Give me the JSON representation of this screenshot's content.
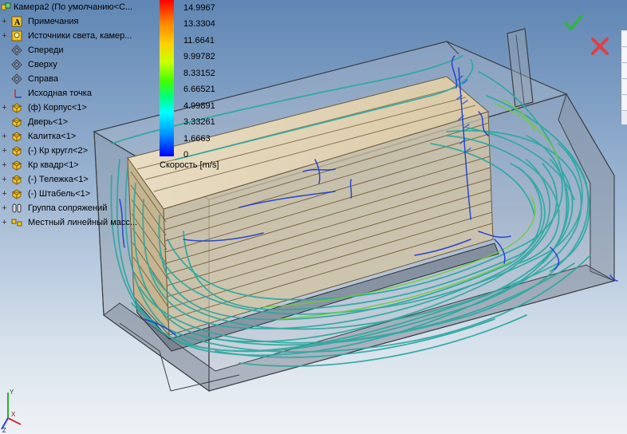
{
  "tree": {
    "root": {
      "label": "Камера2  (По умолчанию<С...",
      "icon": "assembly-icon"
    },
    "items": [
      {
        "label": "Примечания",
        "icon": "annotations-icon",
        "expandable": true
      },
      {
        "label": "Источники света, камер...",
        "icon": "lights-icon",
        "expandable": true
      },
      {
        "label": "Спереди",
        "icon": "plane-icon",
        "expandable": false
      },
      {
        "label": "Сверху",
        "icon": "plane-icon",
        "expandable": false
      },
      {
        "label": "Справа",
        "icon": "plane-icon",
        "expandable": false
      },
      {
        "label": "Исходная точка",
        "icon": "origin-icon",
        "expandable": false
      },
      {
        "label": "(ф) Корпус<1>",
        "icon": "part-icon",
        "expandable": true
      },
      {
        "label": "Дверь<1>",
        "icon": "part-icon",
        "expandable": false
      },
      {
        "label": "Калитка<1>",
        "icon": "part-icon",
        "expandable": true
      },
      {
        "label": "(-) Кр кругл<2>",
        "icon": "part-icon",
        "expandable": true
      },
      {
        "label": "Кр квадр<1>",
        "icon": "part-icon",
        "expandable": true
      },
      {
        "label": "(-) Тележка<1>",
        "icon": "part-icon",
        "expandable": true
      },
      {
        "label": "(-) Штабель<1>",
        "icon": "part-icon",
        "expandable": true
      },
      {
        "label": "Группа сопряжений",
        "icon": "mates-icon",
        "expandable": true
      },
      {
        "label": "Местный линейный масс...",
        "icon": "pattern-icon",
        "expandable": true
      }
    ]
  },
  "legend": {
    "values": [
      "14.9967",
      "13.3304",
      "11.6641",
      "9.99782",
      "8.33152",
      "6.66521",
      "4.99891",
      "3.33261",
      "1.6663",
      "0"
    ],
    "title": "Скорость [m/s]"
  },
  "colors": {
    "tree_icon_yellow": "#f2c230",
    "confirm": "#38b04a",
    "cancel": "#e04040",
    "streamline_teal": "#2aa8a0",
    "streamline_blue": "#1a3ad0",
    "streamline_green": "#6ecc3a"
  },
  "toolbar": {
    "confirm_icon": "check-icon",
    "cancel_icon": "close-icon"
  }
}
